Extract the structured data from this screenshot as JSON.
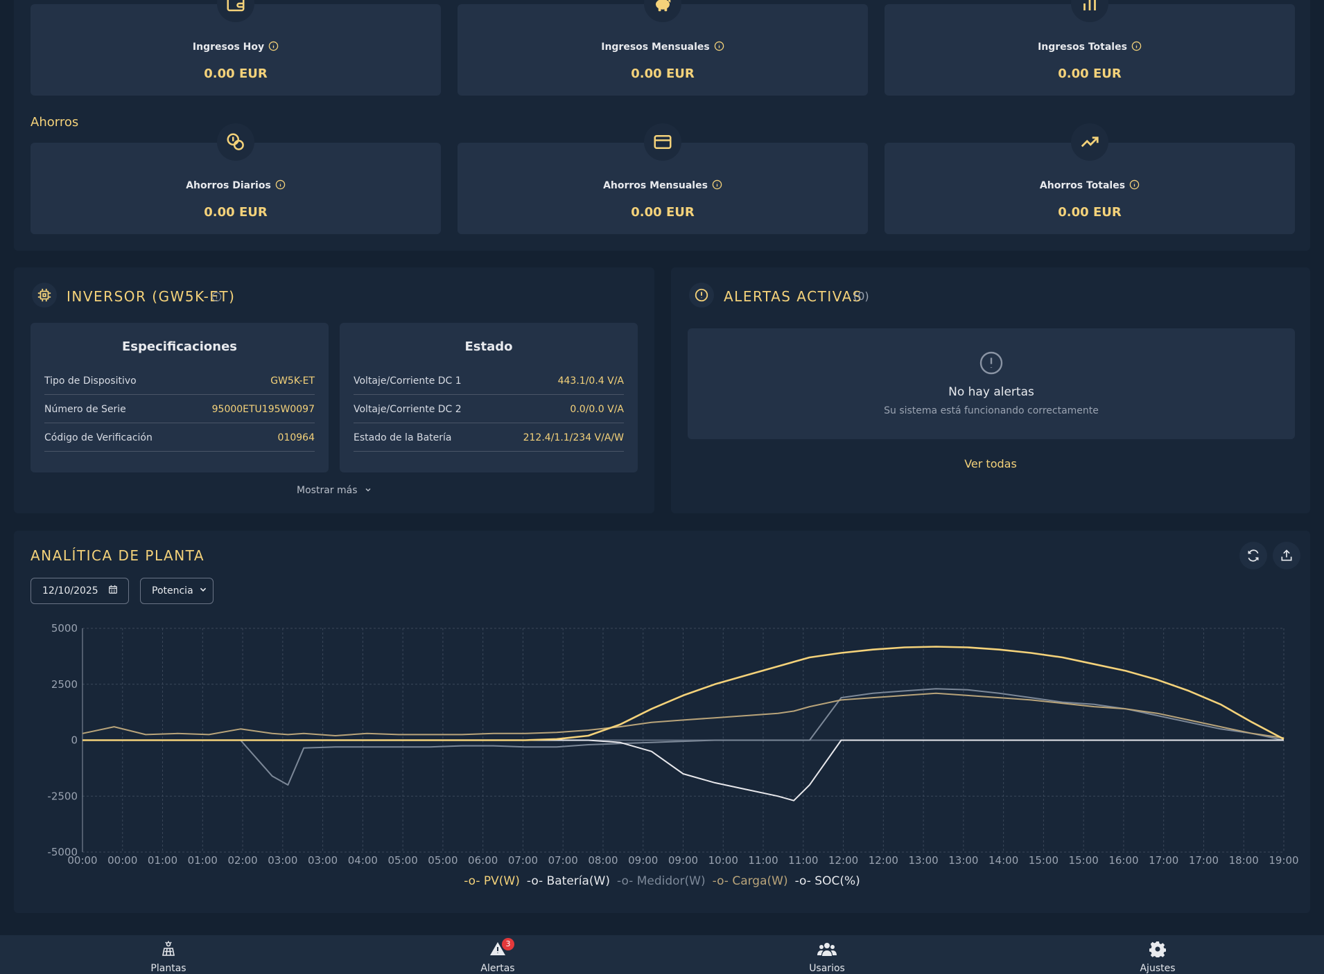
{
  "ingresos": {
    "today_label": "Ingresos Hoy",
    "today_value": "0.00 EUR",
    "monthly_label": "Ingresos Mensuales",
    "monthly_value": "0.00 EUR",
    "total_label": "Ingresos Totales",
    "total_value": "0.00 EUR"
  },
  "ahorros": {
    "section_title": "Ahorros",
    "daily_label": "Ahorros Diarios",
    "daily_value": "0.00 EUR",
    "monthly_label": "Ahorros Mensuales",
    "monthly_value": "0.00 EUR",
    "total_label": "Ahorros Totales",
    "total_value": "0.00 EUR"
  },
  "inverter": {
    "title": "INVERSOR (GW5K-ET)",
    "specs": {
      "title": "Especificaciones",
      "rows": [
        {
          "k": "Tipo de Dispositivo",
          "v": "GW5K-ET"
        },
        {
          "k": "Número de Serie",
          "v": "95000ETU195W0097"
        },
        {
          "k": "Código de Verificación",
          "v": "010964"
        }
      ]
    },
    "status": {
      "title": "Estado",
      "rows": [
        {
          "k": "Voltaje/Corriente DC 1",
          "v": "443.1/0.4 V/A"
        },
        {
          "k": "Voltaje/Corriente DC 2",
          "v": "0.0/0.0 V/A"
        },
        {
          "k": "Estado de la Batería",
          "v": "212.4/1.1/234 V/A/W"
        }
      ]
    },
    "show_more": "Mostrar más"
  },
  "alerts": {
    "title": "ALERTAS ACTIVAS",
    "count": "(0)",
    "empty_title": "No hay alertas",
    "empty_subtitle": "Su sistema está funcionando correctamente",
    "view_all": "Ver todas"
  },
  "analytics": {
    "title": "ANALÍTICA DE PLANTA",
    "date": "12/10/2025",
    "metric": "Potencia"
  },
  "chart_data": {
    "type": "line",
    "ylim": [
      -5000,
      5000
    ],
    "yticks": [
      5000,
      2500,
      0,
      -2500,
      -5000
    ],
    "xtick_labels": [
      "00:00",
      "00:00",
      "01:00",
      "01:00",
      "02:00",
      "03:00",
      "03:00",
      "04:00",
      "05:00",
      "05:00",
      "06:00",
      "07:00",
      "07:00",
      "08:00",
      "09:00",
      "09:00",
      "10:00",
      "11:00",
      "11:00",
      "12:00",
      "12:00",
      "13:00",
      "13:00",
      "14:00",
      "15:00",
      "15:00",
      "16:00",
      "17:00",
      "17:00",
      "18:00",
      "19:00"
    ],
    "x": [
      0,
      0.5,
      1,
      1.5,
      2,
      2.5,
      3,
      3.25,
      3.5,
      4,
      4.5,
      5,
      5.5,
      6,
      6.5,
      7,
      7.5,
      8,
      8.5,
      9,
      9.5,
      10,
      10.5,
      11,
      11.25,
      11.5,
      12,
      12.5,
      13,
      13.5,
      14,
      14.5,
      15,
      15.5,
      16,
      16.5,
      17,
      17.5,
      18,
      18.5,
      19
    ],
    "series": [
      {
        "name": "PV(W)",
        "color": "#f4d27a",
        "values": [
          0,
          0,
          0,
          0,
          0,
          0,
          0,
          0,
          0,
          0,
          0,
          0,
          0,
          0,
          0,
          0,
          50,
          200,
          700,
          1400,
          2000,
          2500,
          2900,
          3300,
          3500,
          3700,
          3900,
          4050,
          4150,
          4180,
          4150,
          4050,
          3900,
          3700,
          3400,
          3100,
          2700,
          2200,
          1600,
          800,
          50
        ]
      },
      {
        "name": "Batería(W)",
        "color": "#e8e8ec",
        "values": [
          0,
          0,
          0,
          0,
          0,
          0,
          0,
          0,
          0,
          0,
          0,
          0,
          0,
          0,
          0,
          0,
          0,
          0,
          -100,
          -500,
          -1500,
          -1900,
          -2200,
          -2500,
          -2700,
          -2000,
          0,
          0,
          0,
          0,
          0,
          0,
          0,
          0,
          0,
          0,
          0,
          0,
          0,
          0,
          0
        ]
      },
      {
        "name": "Medidor(W)",
        "color": "#7c8898",
        "values": [
          0,
          0,
          0,
          0,
          0,
          0,
          -1600,
          -2000,
          -350,
          -300,
          -300,
          -300,
          -300,
          -250,
          -250,
          -300,
          -300,
          -200,
          -150,
          -100,
          -50,
          0,
          0,
          0,
          0,
          0,
          1900,
          2100,
          2200,
          2300,
          2250,
          2100,
          1900,
          1700,
          1600,
          1400,
          1100,
          800,
          500,
          300,
          0
        ]
      },
      {
        "name": "Carga(W)",
        "color": "#b9a47a",
        "values": [
          300,
          600,
          250,
          300,
          250,
          500,
          300,
          250,
          300,
          200,
          300,
          250,
          250,
          250,
          300,
          300,
          350,
          450,
          600,
          800,
          900,
          1000,
          1100,
          1200,
          1300,
          1500,
          1800,
          1900,
          2000,
          2100,
          2000,
          1900,
          1800,
          1650,
          1500,
          1400,
          1200,
          900,
          600,
          300,
          100
        ]
      },
      {
        "name": "SOC(%)",
        "color": "#5f6c7e",
        "values": [
          0,
          0,
          0,
          0,
          0,
          0,
          0,
          0,
          0,
          0,
          0,
          0,
          0,
          0,
          0,
          0,
          0,
          0,
          0,
          0,
          0,
          0,
          0,
          0,
          0,
          0,
          0,
          0,
          0,
          0,
          0,
          0,
          0,
          0,
          0,
          0,
          0,
          0,
          0,
          0,
          0
        ]
      }
    ]
  },
  "nav": {
    "plants": "Plantas",
    "alerts": "Alertas",
    "alerts_badge": "3",
    "users": "Usarios",
    "settings": "Ajustes"
  }
}
